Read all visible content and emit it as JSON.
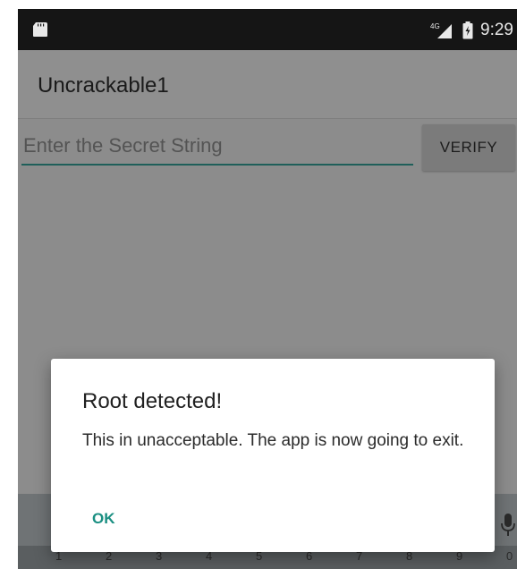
{
  "status_bar": {
    "time": "9:29",
    "network_label": "4G",
    "icons": [
      "sd-card-icon",
      "network-signal-icon",
      "battery-icon"
    ]
  },
  "app_bar": {
    "title": "Uncrackable1"
  },
  "main": {
    "secret_input": {
      "placeholder": "Enter the Secret String",
      "value": ""
    },
    "verify_label": "VERIFY"
  },
  "dialog": {
    "title": "Root detected!",
    "message": "This in unacceptable. The app is now going to exit.",
    "ok_label": "OK"
  },
  "keyboard": {
    "number_row": [
      "1",
      "2",
      "3",
      "4",
      "5",
      "6",
      "7",
      "8",
      "9",
      "0"
    ]
  },
  "colors": {
    "status_bar": "#151515",
    "app_bar": "#8f8f8f",
    "scrim_background": "#8c8c8c",
    "accent": "#1a8f82",
    "input_underline": "#1f5f5a",
    "dialog_background": "#ffffff"
  }
}
